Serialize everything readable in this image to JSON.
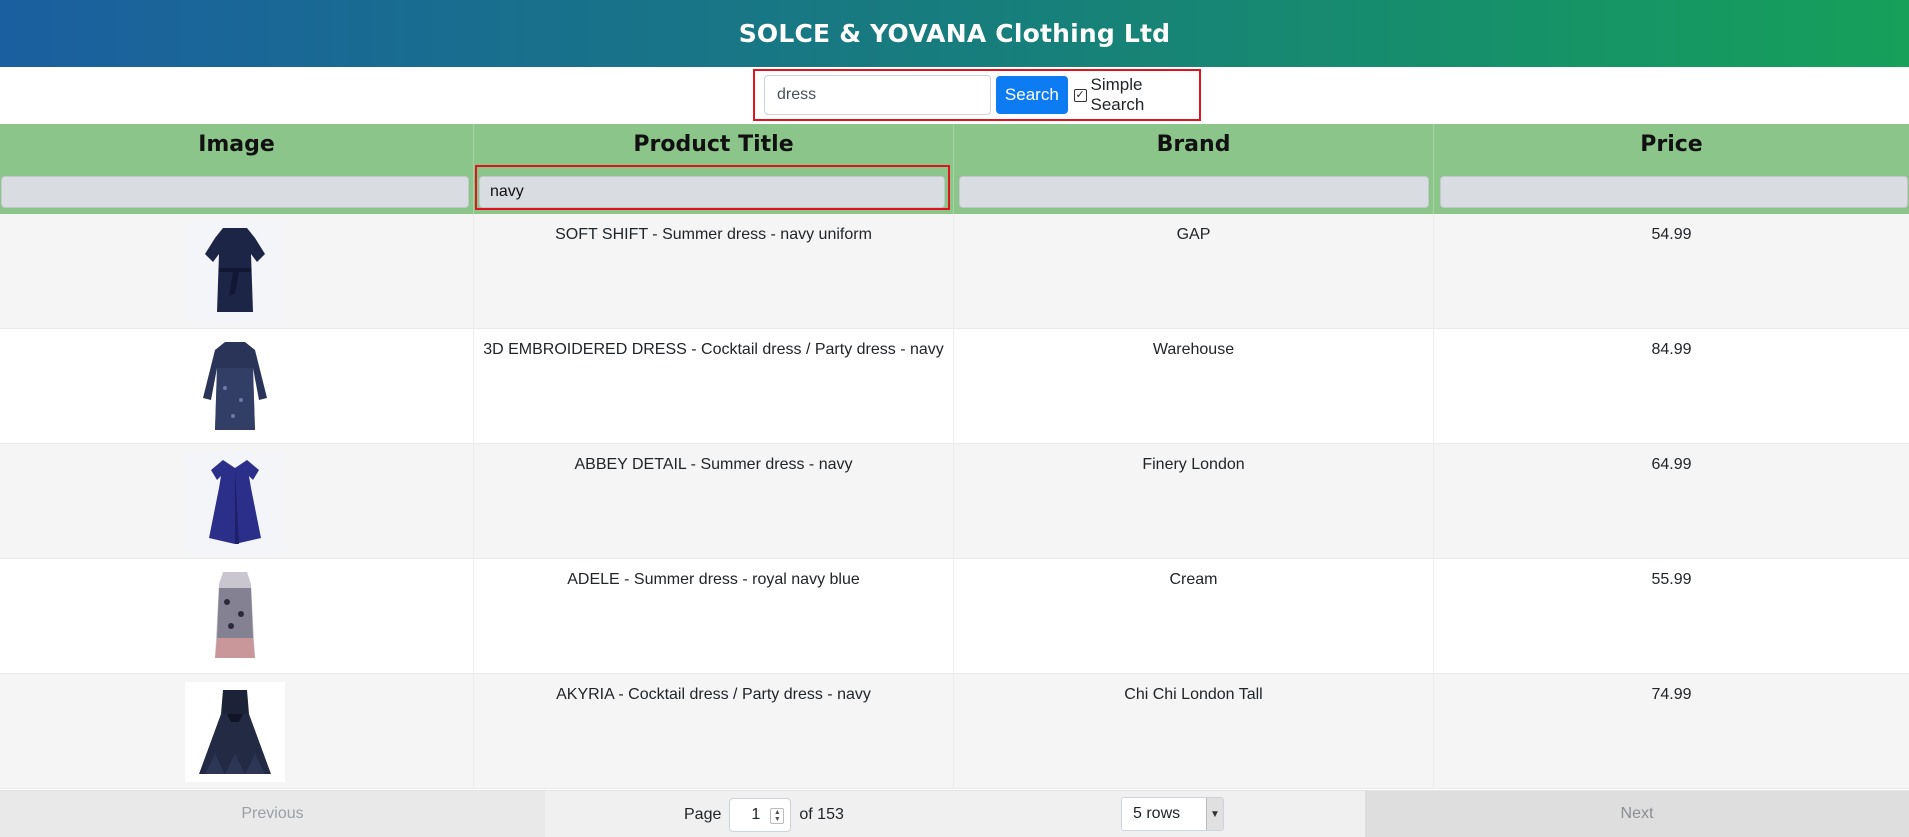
{
  "header": {
    "title": "SOLCE & YOVANA Clothing Ltd"
  },
  "search": {
    "value": "dress",
    "button_label": "Search",
    "simple_search_label": "Simple Search",
    "simple_search_checked": true
  },
  "table": {
    "columns": [
      "Image",
      "Product Title",
      "Brand",
      "Price"
    ],
    "filters": [
      "",
      "navy",
      "",
      ""
    ],
    "rows": [
      {
        "image_icon": "dress-thumbnail",
        "title": "SOFT SHIFT - Summer dress - navy uniform",
        "brand": "GAP",
        "price": "54.99"
      },
      {
        "image_icon": "dress-thumbnail",
        "title": "3D EMBROIDERED DRESS - Cocktail dress / Party dress - navy",
        "brand": "Warehouse",
        "price": "84.99"
      },
      {
        "image_icon": "dress-thumbnail",
        "title": "ABBEY DETAIL - Summer dress - navy",
        "brand": "Finery London",
        "price": "64.99"
      },
      {
        "image_icon": "dress-thumbnail",
        "title": "ADELE - Summer dress - royal navy blue",
        "brand": "Cream",
        "price": "55.99"
      },
      {
        "image_icon": "dress-thumbnail",
        "title": "AKYRIA - Cocktail dress / Party dress - navy",
        "brand": "Chi Chi London Tall",
        "price": "74.99"
      }
    ]
  },
  "pagination": {
    "previous_label": "Previous",
    "next_label": "Next",
    "page_label": "Page",
    "page_value": "1",
    "of_label": "of 153",
    "rows_select": "5 rows"
  },
  "colors": {
    "header_start": "#1a5fa0",
    "header_end": "#16a05a",
    "table_head": "#8cc58a",
    "search_button": "#0d7cf2",
    "highlight": "#e0141e"
  }
}
